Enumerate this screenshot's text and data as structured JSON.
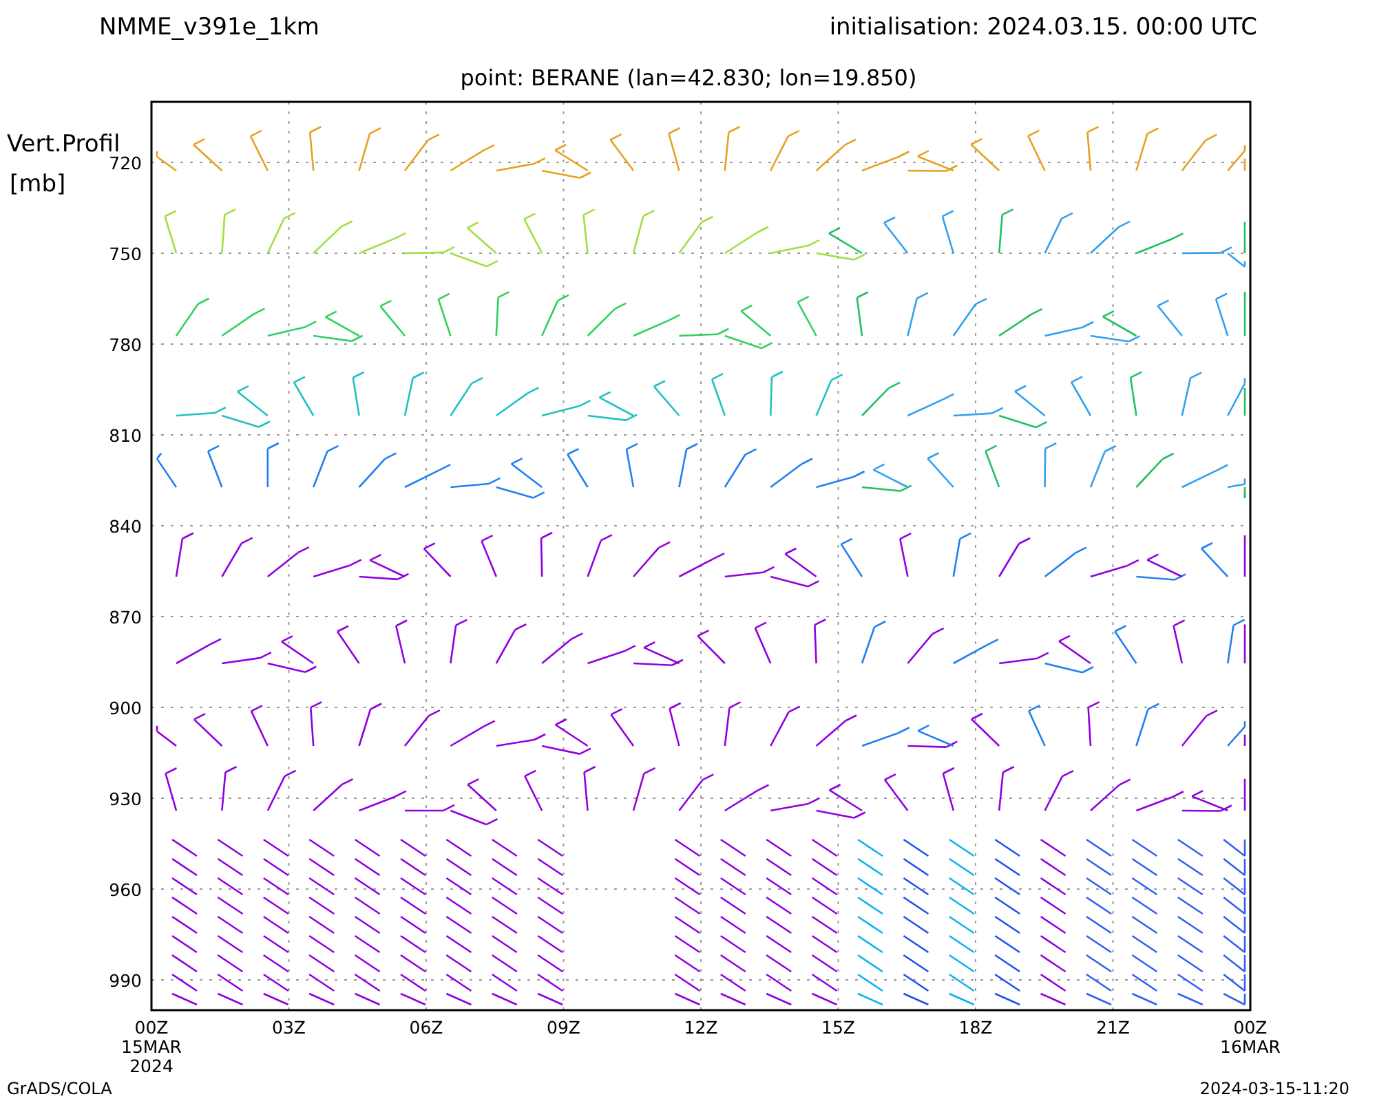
{
  "header": {
    "model": "NMME_v391e_1km",
    "initialisation": "initialisation: 2024.03.15. 00:00 UTC",
    "point": "point: BERANE (lan=42.830; lon=19.850)"
  },
  "y_axis": {
    "label": "Vert.Profil",
    "unit": "[mb]",
    "ticks": [
      "720",
      "750",
      "780",
      "810",
      "840",
      "870",
      "900",
      "930",
      "960",
      "990"
    ]
  },
  "x_axis": {
    "ticks": [
      {
        "label": "00Z",
        "date": "15MAR",
        "year": "2024"
      },
      {
        "label": "03Z"
      },
      {
        "label": "06Z"
      },
      {
        "label": "09Z"
      },
      {
        "label": "12Z"
      },
      {
        "label": "15Z"
      },
      {
        "label": "18Z"
      },
      {
        "label": "21Z"
      },
      {
        "label": "00Z",
        "date": "16MAR"
      }
    ]
  },
  "footer": {
    "left": "GrADS/COLA",
    "right": "2024-03-15-11:20"
  }
}
